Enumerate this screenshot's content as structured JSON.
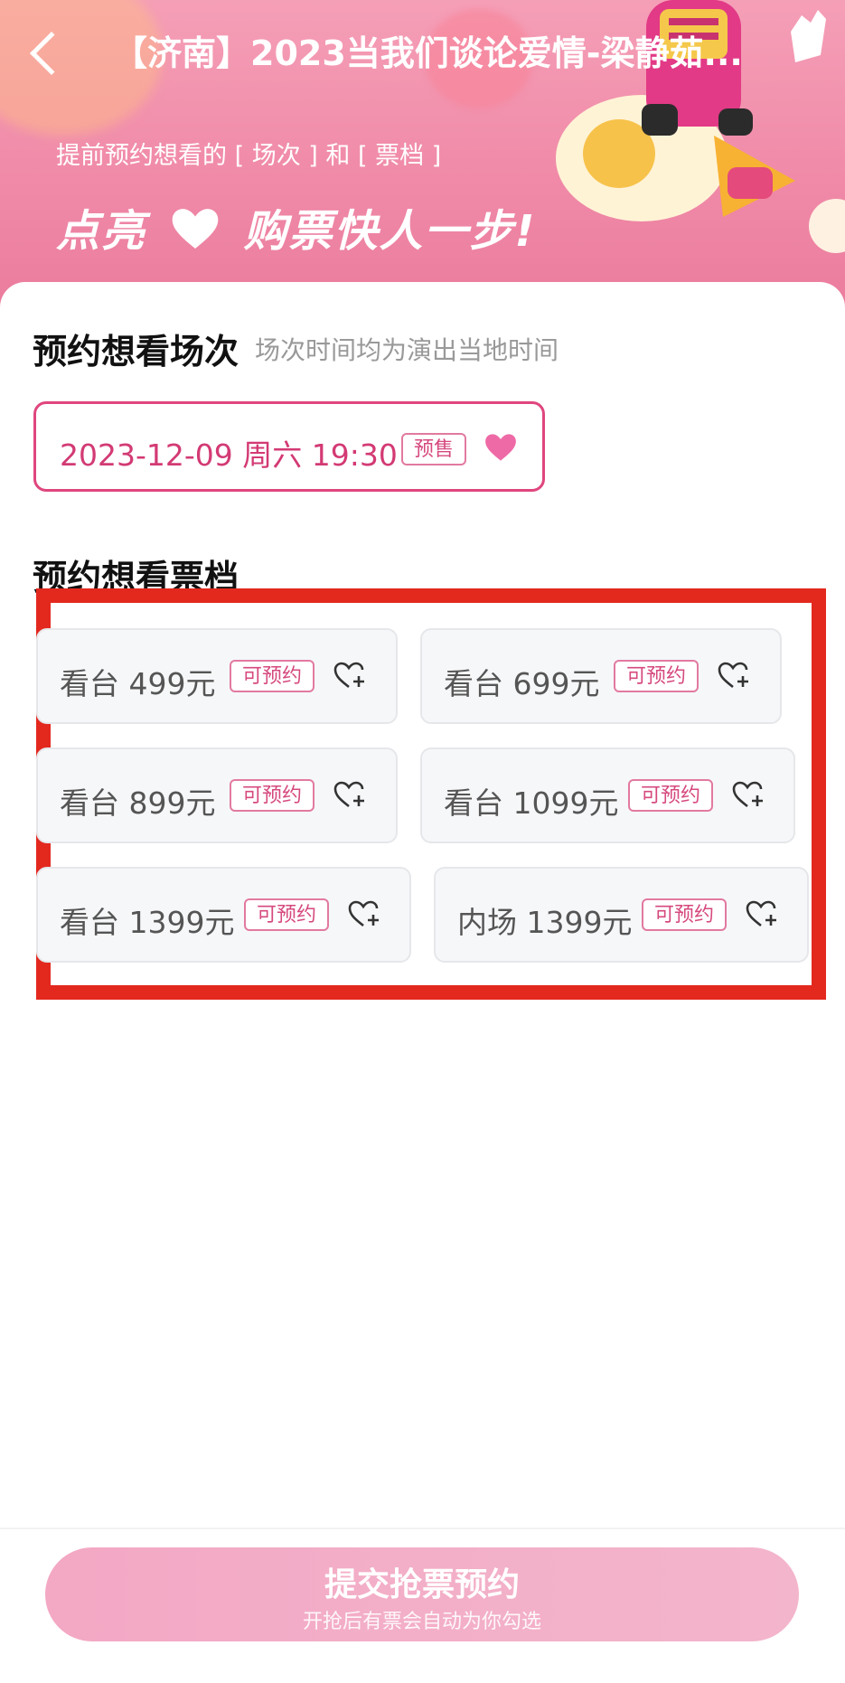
{
  "header": {
    "title": "【济南】2023当我们谈论爱情-梁静茹...",
    "subtitle": "提前预约想看的 [ 场次 ] 和 [ 票档 ]",
    "slogan_left": "点亮",
    "slogan_right": "购票快人一步!"
  },
  "sessions_section": {
    "title": "预约想看场次",
    "note": "场次时间均为演出当地时间",
    "sessions": [
      {
        "datetime": "2023-12-09 周六 19:30",
        "tag": "预售"
      }
    ]
  },
  "tiers_section": {
    "title": "预约想看票档",
    "tiers": [
      {
        "label": "看台 499元",
        "tag": "可预约"
      },
      {
        "label": "看台 699元",
        "tag": "可预约"
      },
      {
        "label": "看台 899元",
        "tag": "可预约"
      },
      {
        "label": "看台 1099元",
        "tag": "可预约"
      },
      {
        "label": "看台 1399元",
        "tag": "可预约"
      },
      {
        "label": "内场 1399元",
        "tag": "可预约"
      }
    ]
  },
  "footer": {
    "submit_label": "提交抢票预约",
    "submit_sub": "开抢后有票会自动为你勾选"
  },
  "colors": {
    "accent": "#e0467e",
    "banner": "#f08aa8",
    "highlight_box": "#e3281e",
    "submit": "#f3b0c8"
  }
}
